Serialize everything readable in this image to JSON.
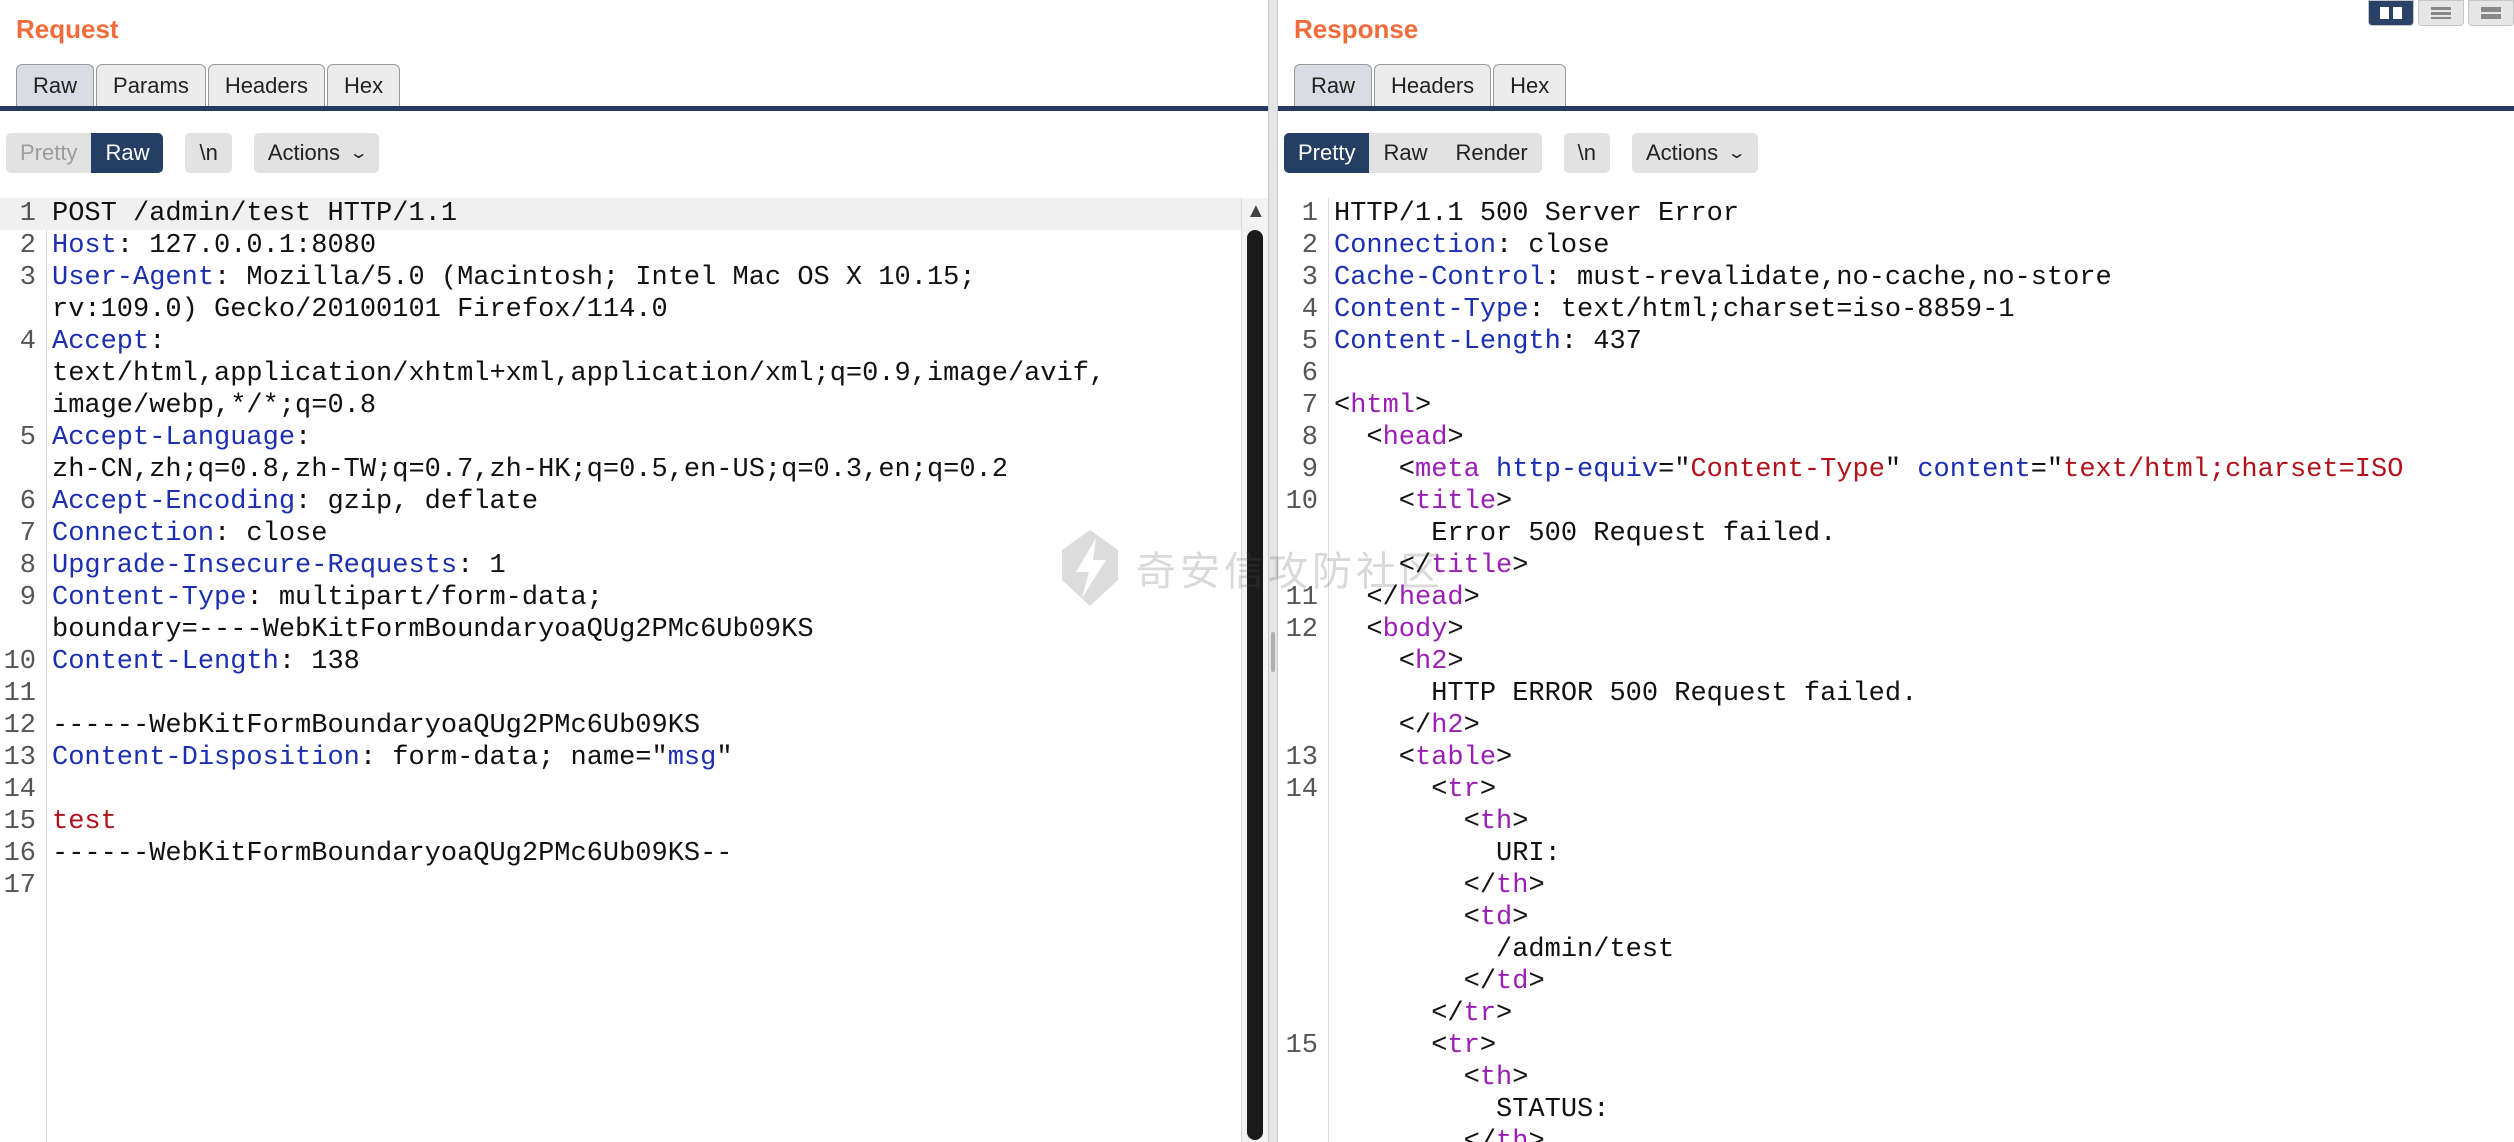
{
  "request": {
    "title": "Request",
    "tabs": [
      "Raw",
      "Params",
      "Headers",
      "Hex"
    ],
    "active_tab": "Raw",
    "view_buttons": [
      "Pretty",
      "Raw"
    ],
    "active_view": "Raw",
    "newline_label": "\\n",
    "actions_label": "Actions",
    "lines": [
      {
        "n": "1",
        "parts": [
          [
            "",
            "POST /admin/test HTTP/1.1"
          ]
        ]
      },
      {
        "n": "2",
        "parts": [
          [
            "hk",
            "Host"
          ],
          [
            "",
            ": 127.0.0.1:8080"
          ]
        ]
      },
      {
        "n": "3",
        "parts": [
          [
            "hk",
            "User-Agent"
          ],
          [
            "",
            ": Mozilla/5.0 (Macintosh; Intel Mac OS X 10.15;"
          ]
        ]
      },
      {
        "n": "",
        "parts": [
          [
            "",
            "rv:109.0) Gecko/20100101 Firefox/114.0"
          ]
        ]
      },
      {
        "n": "4",
        "parts": [
          [
            "hk",
            "Accept"
          ],
          [
            "",
            ":"
          ]
        ]
      },
      {
        "n": "",
        "parts": [
          [
            "",
            "text/html,application/xhtml+xml,application/xml;q=0.9,image/avif,"
          ]
        ]
      },
      {
        "n": "",
        "parts": [
          [
            "",
            "image/webp,*/*;q=0.8"
          ]
        ]
      },
      {
        "n": "5",
        "parts": [
          [
            "hk",
            "Accept-Language"
          ],
          [
            "",
            ":"
          ]
        ]
      },
      {
        "n": "",
        "parts": [
          [
            "",
            "zh-CN,zh;q=0.8,zh-TW;q=0.7,zh-HK;q=0.5,en-US;q=0.3,en;q=0.2"
          ]
        ]
      },
      {
        "n": "6",
        "parts": [
          [
            "hk",
            "Accept-Encoding"
          ],
          [
            "",
            ": gzip, deflate"
          ]
        ]
      },
      {
        "n": "7",
        "parts": [
          [
            "hk",
            "Connection"
          ],
          [
            "",
            ": close"
          ]
        ]
      },
      {
        "n": "8",
        "parts": [
          [
            "hk",
            "Upgrade-Insecure-Requests"
          ],
          [
            "",
            ": 1"
          ]
        ]
      },
      {
        "n": "9",
        "parts": [
          [
            "hk",
            "Content-Type"
          ],
          [
            "",
            ": multipart/form-data;"
          ]
        ]
      },
      {
        "n": "",
        "parts": [
          [
            "",
            "boundary=----WebKitFormBoundaryoaQUg2PMc6Ub09KS"
          ]
        ]
      },
      {
        "n": "10",
        "parts": [
          [
            "hk",
            "Content-Length"
          ],
          [
            "",
            ": 138"
          ]
        ]
      },
      {
        "n": "11",
        "parts": [
          [
            "",
            ""
          ]
        ]
      },
      {
        "n": "12",
        "parts": [
          [
            "",
            "------WebKitFormBoundaryoaQUg2PMc6Ub09KS"
          ]
        ]
      },
      {
        "n": "13",
        "parts": [
          [
            "hk",
            "Content-Disposition"
          ],
          [
            "",
            ": form-data; name=\""
          ],
          [
            "qv",
            "msg"
          ],
          [
            "",
            "\""
          ]
        ]
      },
      {
        "n": "14",
        "parts": [
          [
            "",
            ""
          ]
        ]
      },
      {
        "n": "15",
        "parts": [
          [
            "red",
            "test"
          ]
        ]
      },
      {
        "n": "16",
        "parts": [
          [
            "",
            "------WebKitFormBoundaryoaQUg2PMc6Ub09KS--"
          ]
        ]
      },
      {
        "n": "17",
        "parts": [
          [
            "",
            ""
          ]
        ]
      }
    ]
  },
  "response": {
    "title": "Response",
    "tabs": [
      "Raw",
      "Headers",
      "Hex"
    ],
    "active_tab": "Raw",
    "view_buttons": [
      "Pretty",
      "Raw",
      "Render"
    ],
    "active_view": "Pretty",
    "newline_label": "\\n",
    "actions_label": "Actions",
    "lines": [
      {
        "n": "1",
        "parts": [
          [
            "",
            "HTTP/1.1 500 Server Error"
          ]
        ]
      },
      {
        "n": "2",
        "parts": [
          [
            "hk",
            "Connection"
          ],
          [
            "",
            ": close"
          ]
        ]
      },
      {
        "n": "3",
        "parts": [
          [
            "hk",
            "Cache-Control"
          ],
          [
            "",
            ": must-revalidate,no-cache,no-store"
          ]
        ]
      },
      {
        "n": "4",
        "parts": [
          [
            "hk",
            "Content-Type"
          ],
          [
            "",
            ": text/html;charset=iso-8859-1"
          ]
        ]
      },
      {
        "n": "5",
        "parts": [
          [
            "hk",
            "Content-Length"
          ],
          [
            "",
            ": 437"
          ]
        ]
      },
      {
        "n": "6",
        "parts": [
          [
            "",
            ""
          ]
        ]
      },
      {
        "n": "7",
        "parts": [
          [
            "",
            "<"
          ],
          [
            "tag",
            "html"
          ],
          [
            "",
            ">"
          ]
        ]
      },
      {
        "n": "8",
        "parts": [
          [
            "",
            "  <"
          ],
          [
            "tag",
            "head"
          ],
          [
            "",
            ">"
          ]
        ]
      },
      {
        "n": "9",
        "parts": [
          [
            "",
            "    <"
          ],
          [
            "tag",
            "meta"
          ],
          [
            "",
            " "
          ],
          [
            "attr",
            "http-equiv"
          ],
          [
            "",
            "=\""
          ],
          [
            "aval",
            "Content-Type"
          ],
          [
            "",
            "\" "
          ],
          [
            "attr",
            "content"
          ],
          [
            "",
            "=\""
          ],
          [
            "aval",
            "text/html;charset=ISO"
          ]
        ]
      },
      {
        "n": "10",
        "parts": [
          [
            "",
            "    <"
          ],
          [
            "tag",
            "title"
          ],
          [
            "",
            ">"
          ]
        ]
      },
      {
        "n": "",
        "parts": [
          [
            "",
            "      Error 500 Request failed."
          ]
        ]
      },
      {
        "n": "",
        "parts": [
          [
            "",
            "    </"
          ],
          [
            "tag",
            "title"
          ],
          [
            "",
            ">"
          ]
        ]
      },
      {
        "n": "11",
        "parts": [
          [
            "",
            "  </"
          ],
          [
            "tag",
            "head"
          ],
          [
            "",
            ">"
          ]
        ]
      },
      {
        "n": "12",
        "parts": [
          [
            "",
            "  <"
          ],
          [
            "tag",
            "body"
          ],
          [
            "",
            ">"
          ]
        ]
      },
      {
        "n": "",
        "parts": [
          [
            "",
            "    <"
          ],
          [
            "tag",
            "h2"
          ],
          [
            "",
            ">"
          ]
        ]
      },
      {
        "n": "",
        "parts": [
          [
            "",
            "      HTTP ERROR 500 Request failed."
          ]
        ]
      },
      {
        "n": "",
        "parts": [
          [
            "",
            "    </"
          ],
          [
            "tag",
            "h2"
          ],
          [
            "",
            ">"
          ]
        ]
      },
      {
        "n": "13",
        "parts": [
          [
            "",
            "    <"
          ],
          [
            "tag",
            "table"
          ],
          [
            "",
            ">"
          ]
        ]
      },
      {
        "n": "14",
        "parts": [
          [
            "",
            "      <"
          ],
          [
            "tag",
            "tr"
          ],
          [
            "",
            ">"
          ]
        ]
      },
      {
        "n": "",
        "parts": [
          [
            "",
            "        <"
          ],
          [
            "tag",
            "th"
          ],
          [
            "",
            ">"
          ]
        ]
      },
      {
        "n": "",
        "parts": [
          [
            "",
            "          URI:"
          ]
        ]
      },
      {
        "n": "",
        "parts": [
          [
            "",
            "        </"
          ],
          [
            "tag",
            "th"
          ],
          [
            "",
            ">"
          ]
        ]
      },
      {
        "n": "",
        "parts": [
          [
            "",
            "        <"
          ],
          [
            "tag",
            "td"
          ],
          [
            "",
            ">"
          ]
        ]
      },
      {
        "n": "",
        "parts": [
          [
            "",
            "          /admin/test"
          ]
        ]
      },
      {
        "n": "",
        "parts": [
          [
            "",
            "        </"
          ],
          [
            "tag",
            "td"
          ],
          [
            "",
            ">"
          ]
        ]
      },
      {
        "n": "",
        "parts": [
          [
            "",
            "      </"
          ],
          [
            "tag",
            "tr"
          ],
          [
            "",
            ">"
          ]
        ]
      },
      {
        "n": "15",
        "parts": [
          [
            "",
            "      <"
          ],
          [
            "tag",
            "tr"
          ],
          [
            "",
            ">"
          ]
        ]
      },
      {
        "n": "",
        "parts": [
          [
            "",
            "        <"
          ],
          [
            "tag",
            "th"
          ],
          [
            "",
            ">"
          ]
        ]
      },
      {
        "n": "",
        "parts": [
          [
            "",
            "          STATUS:"
          ]
        ]
      },
      {
        "n": "",
        "parts": [
          [
            "",
            "        </"
          ],
          [
            "tag",
            "th"
          ],
          [
            "",
            ">"
          ]
        ]
      }
    ]
  },
  "view_layout_icons": [
    "split-view-icon",
    "list-view-icon",
    "columns-view-icon"
  ],
  "watermark_text": "奇安信攻防社区",
  "colors": {
    "title_orange": "#f26b3a",
    "active_navy": "#253e63",
    "header_key_blue": "#1c2fb0",
    "tag_purple": "#9a1fb5",
    "value_red": "#b1121b"
  }
}
